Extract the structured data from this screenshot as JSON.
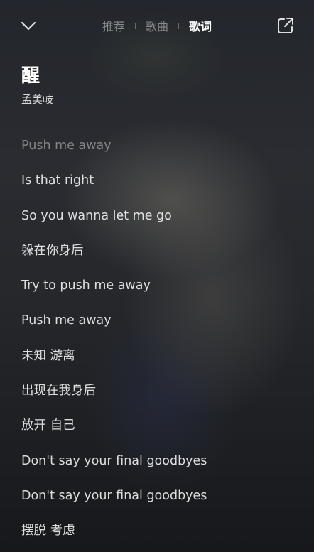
{
  "header": {
    "tabs": [
      {
        "label": "推荐"
      },
      {
        "label": "歌曲"
      },
      {
        "label": "歌词"
      }
    ],
    "active_tab": "歌词",
    "left_icon": "chevron-down-icon",
    "right_icon": "share-external-icon"
  },
  "song": {
    "title": "醒",
    "artist": "孟美岐"
  },
  "lyrics": [
    "Push me away",
    "Is that right",
    "So you wanna let me go",
    "躲在你身后",
    "Try to push me away",
    "Push me away",
    "未知 游离",
    "出现在我身后",
    "放开 自己",
    "Don't say your final goodbyes",
    "Don't say your final goodbyes",
    "摆脱 考虑"
  ],
  "colors": {
    "active_text": "#ffffff",
    "inactive_tab": "rgba(255,255,255,0.45)",
    "dim_lyric": "rgba(255,255,255,0.42)"
  }
}
